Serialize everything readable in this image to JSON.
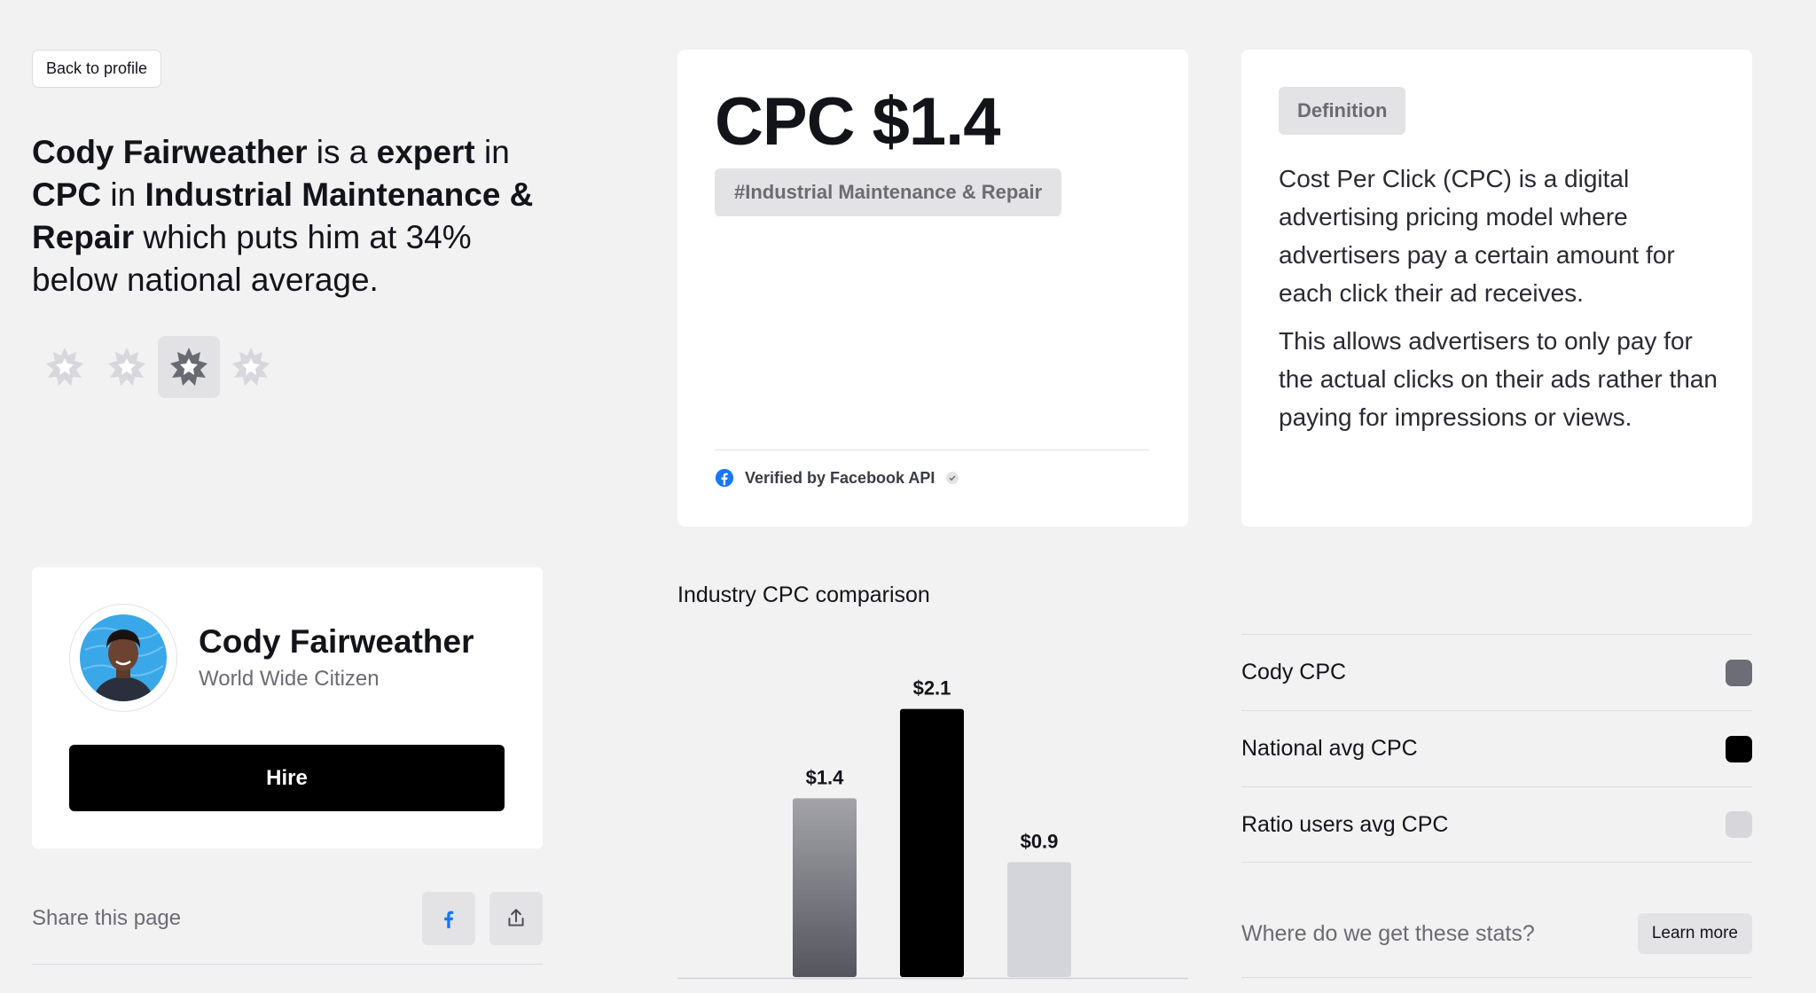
{
  "back_button": {
    "label": "Back to profile"
  },
  "headline": {
    "name": "Cody Fairweather",
    "t1": " is a ",
    "level": "expert",
    "t2": " in ",
    "metric": "CPC",
    "t3": " in ",
    "industry": "Industrial Maintenance & Repair",
    "t4": " which puts him at 34% below national average."
  },
  "rating": {
    "level": 3,
    "max": 4
  },
  "profile": {
    "name": "Cody Fairweather",
    "subtitle": "World Wide Citizen",
    "hire_label": "Hire"
  },
  "share": {
    "label": "Share this page",
    "icons": [
      "facebook-icon",
      "share-icon"
    ]
  },
  "cpc_card": {
    "title": "CPC $1.4",
    "tag": "#Industrial Maintenance & Repair",
    "verified": "Verified by Facebook API"
  },
  "definition": {
    "badge": "Definition",
    "p1": "Cost Per Click (CPC) is a digital advertising pricing model where advertisers pay a certain amount for each click their ad receives.",
    "p2": "This allows advertisers to only pay for the actual clicks on their ads rather than paying for impressions or views."
  },
  "chart_data": {
    "type": "bar",
    "title": "Industry CPC comparison",
    "categories": [
      "Cody CPC",
      "National avg CPC",
      "Ratio users avg CPC"
    ],
    "values": [
      1.4,
      2.1,
      0.9
    ],
    "value_labels": [
      "$1.4",
      "$2.1",
      "$0.9"
    ],
    "colors": [
      "#5f5f68",
      "#000000",
      "#d4d5da"
    ],
    "grid": false,
    "legend": "right"
  },
  "legend": {
    "items": [
      {
        "label": "Cody CPC",
        "color": "#6d6d75"
      },
      {
        "label": "National avg CPC",
        "color": "#000000"
      },
      {
        "label": "Ratio users avg CPC",
        "color": "#d6d6db"
      }
    ]
  },
  "stats": {
    "question": "Where do we get these stats?",
    "learn_more": "Learn more"
  }
}
